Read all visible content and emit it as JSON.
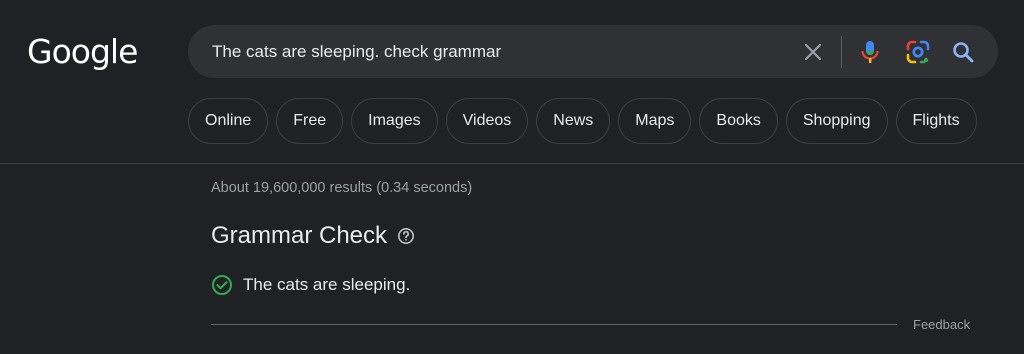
{
  "logo": {
    "text": "Google"
  },
  "search": {
    "query": "The cats are sleeping. check grammar"
  },
  "icons": {
    "clear": "close-icon",
    "mic": "microphone-icon",
    "lens": "lens-camera-icon",
    "search": "search-icon"
  },
  "chips": [
    "Online",
    "Free",
    "Images",
    "Videos",
    "News",
    "Maps",
    "Books",
    "Shopping",
    "Flights"
  ],
  "stats": "About 19,600,000 results (0.34 seconds)",
  "grammar": {
    "title": "Grammar Check",
    "result": "The cats are sleeping."
  },
  "feedback": "Feedback",
  "colors": {
    "background": "#202124",
    "searchbox": "#303134",
    "check_green": "#34a853",
    "mic_blue": "#4285f4",
    "mic_red": "#ea4335",
    "muted_text": "#9aa0a6"
  }
}
